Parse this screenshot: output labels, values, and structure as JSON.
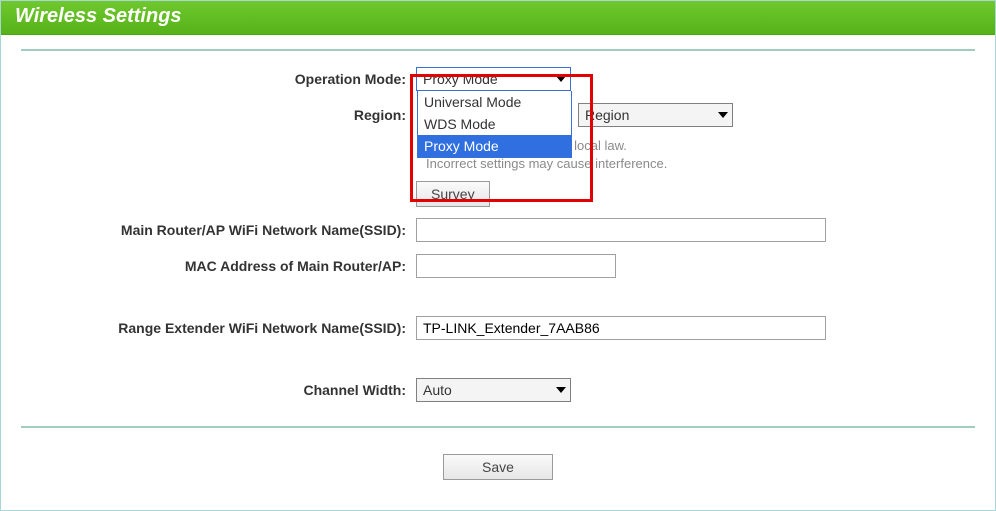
{
  "header": {
    "title": "Wireless Settings"
  },
  "labels": {
    "operation_mode": "Operation Mode:",
    "region": "Region:",
    "ssid_main": "Main Router/AP WiFi Network Name(SSID):",
    "mac_main": "MAC Address of Main Router/AP:",
    "ssid_extender": "Range Extender WiFi Network Name(SSID):",
    "channel_width": "Channel Width:"
  },
  "operation_mode": {
    "selected": "Proxy Mode",
    "options": [
      "Universal Mode",
      "WDS Mode",
      "Proxy Mode"
    ]
  },
  "region": {
    "selected": "Region"
  },
  "help": {
    "line1": "orrect country to conform local law.",
    "line2": "Incorrect settings may cause interference."
  },
  "buttons": {
    "survey": "Survey",
    "save": "Save"
  },
  "fields": {
    "ssid_main_value": "",
    "mac_main_value": "",
    "ssid_extender_value": "TP-LINK_Extender_7AAB86"
  },
  "channel_width": {
    "selected": "Auto"
  }
}
